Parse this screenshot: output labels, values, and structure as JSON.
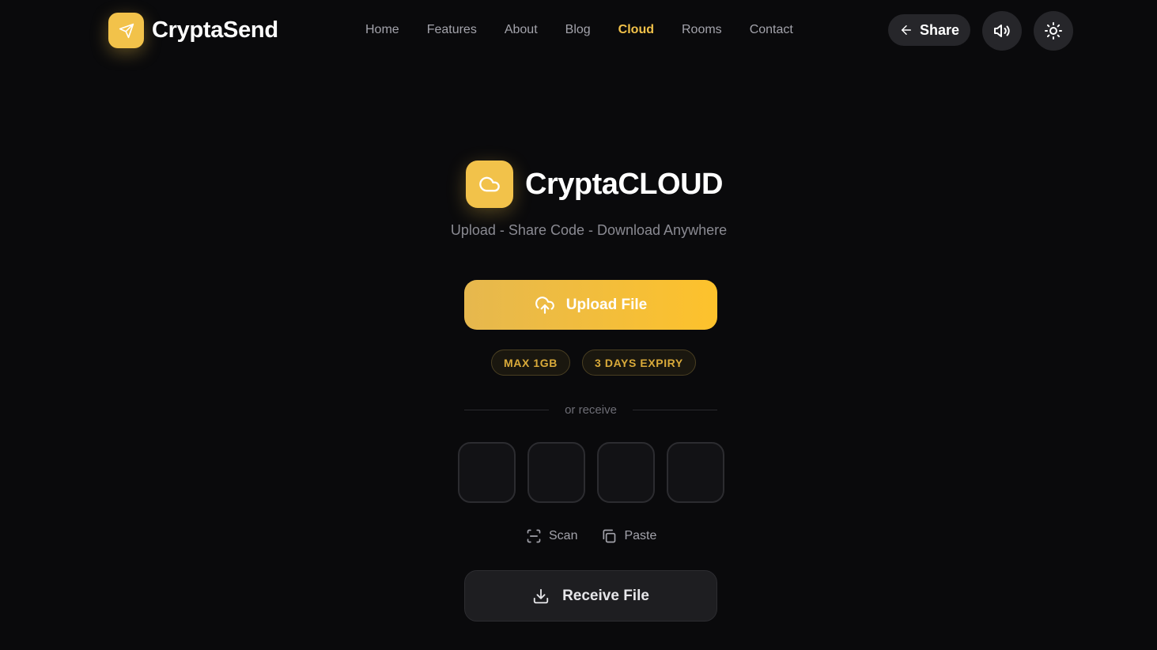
{
  "brand": {
    "name": "CryptaSend",
    "icon": "paper-plane-icon"
  },
  "nav": {
    "items": [
      {
        "label": "Home",
        "active": false
      },
      {
        "label": "Features",
        "active": false
      },
      {
        "label": "About",
        "active": false
      },
      {
        "label": "Blog",
        "active": false
      },
      {
        "label": "Cloud",
        "active": true
      },
      {
        "label": "Rooms",
        "active": false
      },
      {
        "label": "Contact",
        "active": false
      }
    ]
  },
  "header_actions": {
    "share_label": "Share",
    "share_icon": "arrow-left-icon",
    "sound_icon": "speaker-icon",
    "theme_icon": "sun-icon"
  },
  "hero": {
    "title": "CryptaCLOUD",
    "icon": "cloud-icon",
    "subtitle": "Upload - Share Code - Download Anywhere"
  },
  "upload": {
    "label": "Upload File",
    "icon": "cloud-upload-icon"
  },
  "tags": [
    "MAX 1GB",
    "3 DAYS EXPIRY"
  ],
  "divider": {
    "text": "or receive"
  },
  "code_inputs": [
    "",
    "",
    "",
    ""
  ],
  "aux": {
    "scan_label": "Scan",
    "scan_icon": "scan-icon",
    "paste_label": "Paste",
    "paste_icon": "copy-icon"
  },
  "receive": {
    "label": "Receive File",
    "icon": "download-icon"
  },
  "colors": {
    "accent": "#f2c24a",
    "background": "#0a0a0c",
    "surface": "#26262a"
  }
}
